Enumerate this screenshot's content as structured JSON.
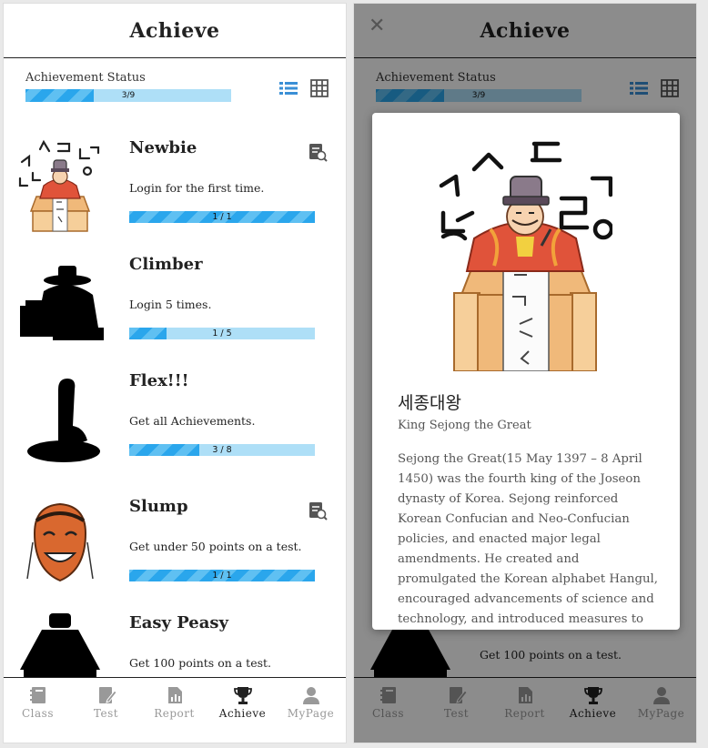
{
  "left": {
    "header": {
      "title": "Achieve"
    },
    "status": {
      "label": "Achievement Status",
      "progress_text": "3/9",
      "progress_fraction": 0.333
    },
    "achievements": [
      {
        "title": "Newbie",
        "desc": "Login for the first time.",
        "progress_text": "1 / 1",
        "progress_fraction": 1.0,
        "image": "sejong-illustration",
        "has_detail": true
      },
      {
        "title": "Climber",
        "desc": "Login 5 times.",
        "progress_text": "1 / 5",
        "progress_fraction": 0.2,
        "image": "locked-silhouette",
        "has_detail": false
      },
      {
        "title": "Flex!!!",
        "desc": "Get all Achievements.",
        "progress_text": "3 / 8",
        "progress_fraction": 0.375,
        "image": "locked-silhouette",
        "has_detail": false
      },
      {
        "title": "Slump",
        "desc": "Get under 50 points on a test.",
        "progress_text": "1 / 1",
        "progress_fraction": 1.0,
        "image": "mask-illustration",
        "has_detail": true
      },
      {
        "title": "Easy Peasy",
        "desc": "Get 100 points on a test.",
        "image": "locked-silhouette"
      }
    ]
  },
  "right": {
    "header": {
      "title": "Achieve"
    },
    "status": {
      "label": "Achievement Status",
      "progress_text": "3/9",
      "progress_fraction": 0.333
    },
    "bottom_peek": {
      "desc": "Get 100 points on a test."
    },
    "modal": {
      "title": "세종대왕",
      "subtitle": "King Sejong the Great",
      "text": "Sejong the Great(15 May 1397 – 8 April 1450) was the fourth king of the Joseon dynasty of Korea. Sejong reinforced Korean Confucian and Neo-Confucian policies, and enacted major legal amendments. He created and promulgated the Korean alphabet Hangul, encouraged advancements of science and technology, and introduced measures to stimulate"
    }
  },
  "tabs": [
    {
      "label": "Class",
      "icon": "book-icon"
    },
    {
      "label": "Test",
      "icon": "pencil-icon"
    },
    {
      "label": "Report",
      "icon": "report-icon"
    },
    {
      "label": "Achieve",
      "icon": "trophy-icon",
      "active": true
    },
    {
      "label": "MyPage",
      "icon": "user-icon"
    }
  ],
  "colors": {
    "progress_track": "#aedff7",
    "progress_fill": "#2aa6ec",
    "accent_blue": "#3a8fd6",
    "tab_inactive": "#999999",
    "tab_active": "#222222",
    "overlay": "rgba(0,0,0,0.45)"
  }
}
